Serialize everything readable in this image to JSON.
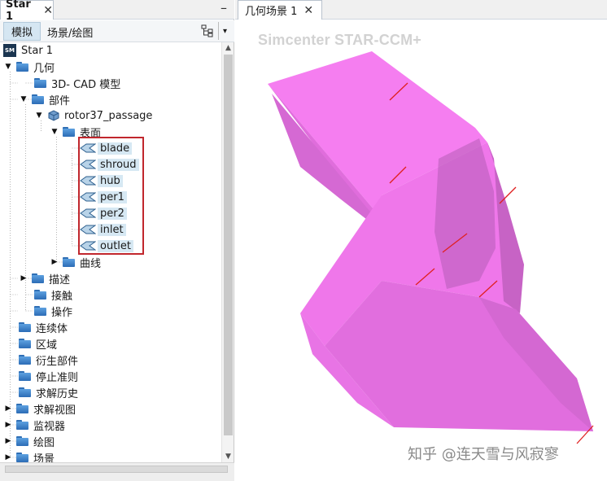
{
  "left_panel": {
    "window_tab": "Star 1",
    "close_glyph": "✕",
    "minimize_glyph": "–",
    "sub_tabs": {
      "simulation": "模拟",
      "scene_plot": "场景/绘图"
    },
    "tree_view_icon": "tree-structure-icon",
    "dropdown_glyph": "▾"
  },
  "tree": {
    "root": "Star 1",
    "root_badge": "SM",
    "geometry": "几何",
    "cad_model": "3D- CAD 模型",
    "parts": "部件",
    "rotor": "rotor37_passage",
    "surfaces": "表面",
    "surface_items": [
      "blade",
      "shroud",
      "hub",
      "per1",
      "per2",
      "inlet",
      "outlet"
    ],
    "curves": "曲线",
    "descriptions": "描述",
    "contacts": "接触",
    "operations": "操作",
    "continua": "连续体",
    "regions": "区域",
    "derived_parts": "衍生部件",
    "stopping_criteria": "停止准则",
    "solution_histories": "求解历史",
    "solution_views": "求解视图",
    "monitors": "监视器",
    "plots": "绘图",
    "scenes": "场景"
  },
  "right_panel": {
    "scene_tab": "几何场景 1",
    "close_glyph": "✕",
    "brand": "Simcenter STAR-CCM+",
    "watermark": "知乎 @连天雪与风寂寥"
  },
  "colors": {
    "geometry_light": "#f57ef0",
    "geometry_mid": "#e570e2",
    "geometry_dark": "#b95cba",
    "edge_red": "#e02020",
    "highlight_box": "#c1272d",
    "selection_bg": "#d6e8f3"
  }
}
